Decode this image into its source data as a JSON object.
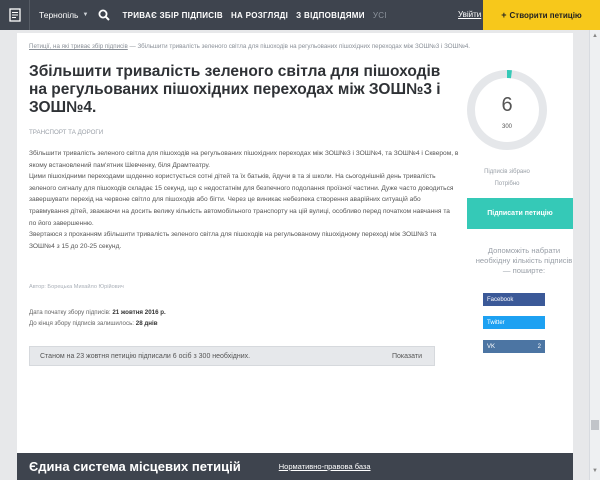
{
  "header": {
    "city": "Тернопіль",
    "nav": [
      {
        "label": "Триває збір підписів",
        "dim": false
      },
      {
        "label": "На розгляді",
        "dim": false
      },
      {
        "label": "З відповідями",
        "dim": false
      },
      {
        "label": "Усі",
        "dim": true
      }
    ],
    "login": "Увійти",
    "create_button": "Створити петицію",
    "icons": {
      "logo": "petition-doc-icon",
      "search": "search-icon",
      "caret": "chevron-down-icon"
    }
  },
  "breadcrumb": {
    "parent": "Петиції, на які триває збір підписів",
    "separator": " — ",
    "current": "Збільшити тривалість зеленого світла для пішоходів на регульованих пішохідних переходах між ЗОШ№3 і ЗОШ№4."
  },
  "petition": {
    "title": "Збільшити тривалість зеленого світла для пішоходів на регульованих пішохідних переходах між ЗОШ№3 і ЗОШ№4.",
    "category": "Транспорт та дороги",
    "paragraphs": [
      "Збільшити тривалість зеленого світла для пішоходів на регульованих пішохідних переходах між ЗОШ№3 і ЗОШ№4, та ЗОШ№4 і Сквером, в якому встановлений пам'ятник Шевченку, біля Драмтеатру.",
      "Цими пішохідними переходами щоденно користується сотні дітей та їх батьків, йдучи в та зі школи. На сьогоднішній день тривалість зеленого сигналу для пішоходів складає 15 секунд, що є недостатнім для безпечного подолання проїзної частини. Дуже часто доводиться завершувати перехід на червоне світло для пішоходів або бігти. Через це виникає небезпека створення аварійних ситуацій або травмування дітей, зважаючи на досить велику кількість автомобільного транспорту на цій вулиці, особливо перед початком навчання та по його завершенню.",
      "Звертаюся з проханням збільшити тривалість зеленого світла для пішоходів на регульованому пішохідному переході між ЗОШ№3 та ЗОШ№4 з 15 до 20-25 секунд."
    ],
    "author_label": "Автор:",
    "author": "Борецька Михайло Юрійович",
    "start_label": "Дата початку збору підписів:",
    "start_date": "21 жовтня 2016 р.",
    "remaining_label": "До кінця збору підписів залишилось:",
    "remaining": "28 днів",
    "status_text": "Станом на 23 жовтня петицію підписали 6 осіб з 300 необхідних.",
    "show_label": "Показати"
  },
  "sidebar": {
    "signed": 6,
    "needed": 300,
    "signed_label": "Підписів зібрано",
    "needed_label": "Потрібно",
    "sign_button": "Підписати петицію",
    "help_text": "Допоможіть набрати необхідну кількість підписів — поширте:",
    "share": [
      {
        "label": "Facebook",
        "count": ""
      },
      {
        "label": "Twitter",
        "count": ""
      },
      {
        "label": "VK",
        "count": "2"
      }
    ],
    "colors": {
      "ring_track": "#e5e7ea",
      "ring_progress": "#35c9b7"
    }
  },
  "footer": {
    "title": "Єдина система місцевих петицій",
    "link": "Нормативно-правова база"
  }
}
